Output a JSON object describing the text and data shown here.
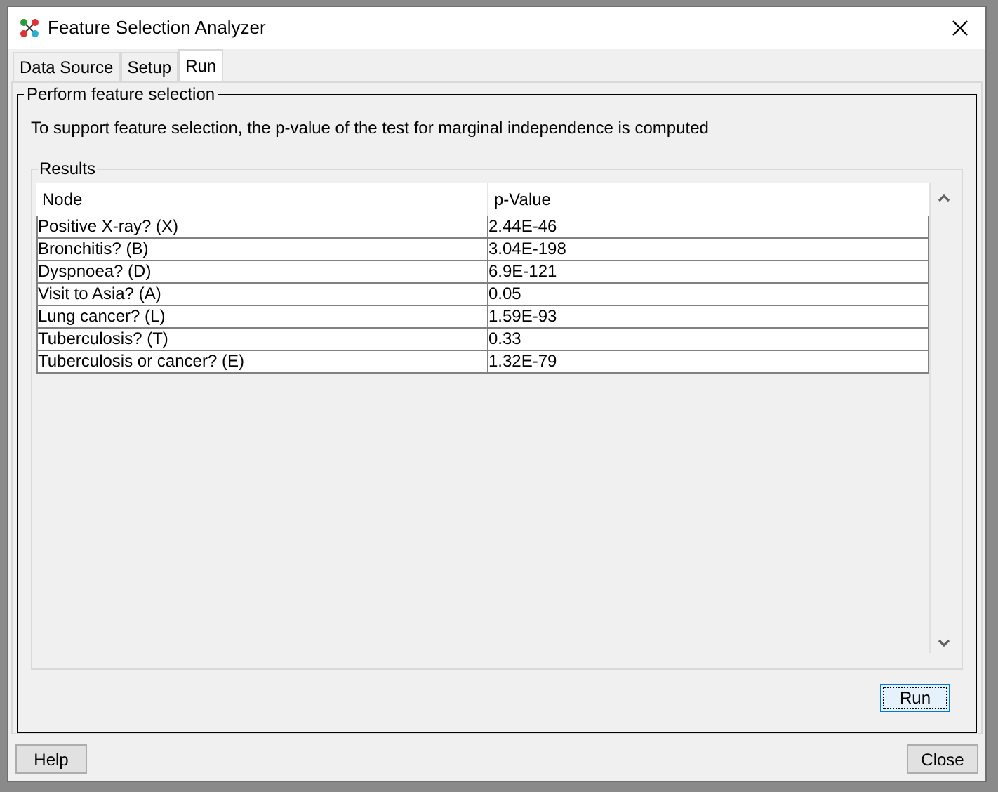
{
  "window": {
    "title": "Feature Selection Analyzer"
  },
  "tabs": [
    {
      "label": "Data Source",
      "selected": false
    },
    {
      "label": "Setup",
      "selected": false
    },
    {
      "label": "Run",
      "selected": true
    }
  ],
  "group": {
    "title": "Perform feature selection",
    "description": "To support feature selection, the p-value of the test for marginal independence is computed"
  },
  "results": {
    "title": "Results",
    "columns": [
      "Node",
      "p-Value"
    ],
    "rows": [
      [
        "Positive X-ray? (X)",
        "2.44E-46"
      ],
      [
        "Bronchitis? (B)",
        "3.04E-198"
      ],
      [
        "Dyspnoea? (D)",
        "6.9E-121"
      ],
      [
        "Visit to Asia? (A)",
        "0.05"
      ],
      [
        "Lung cancer? (L)",
        "1.59E-93"
      ],
      [
        "Tuberculosis? (T)",
        "0.33"
      ],
      [
        "Tuberculosis or cancer? (E)",
        "1.32E-79"
      ]
    ]
  },
  "run_button": "Run",
  "buttons": [
    "Help",
    "Close"
  ]
}
